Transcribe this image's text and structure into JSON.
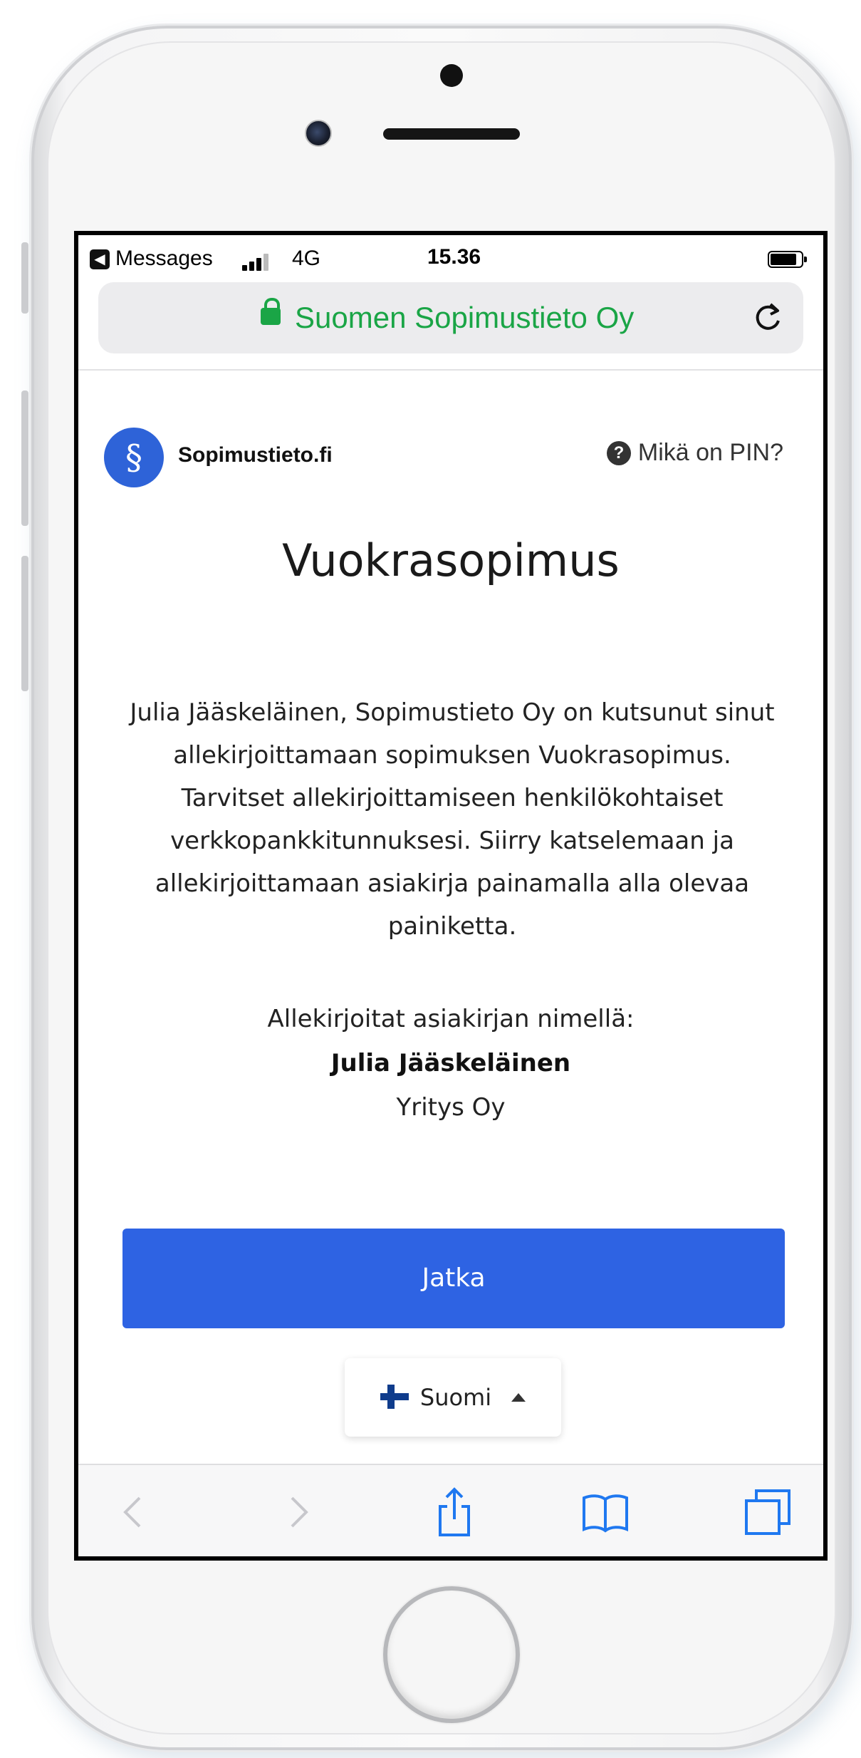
{
  "status_bar": {
    "app": "Messages",
    "network": "4G",
    "time": "15.36"
  },
  "url_bar": {
    "site": "Suomen Sopimustieto Oy"
  },
  "brand": {
    "logo_symbol": "§",
    "name": "Sopimustieto.fi"
  },
  "pin_help": {
    "label": "Mikä on PIN?"
  },
  "document": {
    "title": "Vuokrasopimus",
    "intro": "Julia Jääskeläinen, Sopimustieto Oy on kutsunut sinut allekirjoittamaan sopimuksen Vuokrasopimus. Tarvitset allekirjoittamiseen henkilökohtaiset verkkopankkitunnuksesi. Siirry katselemaan ja allekirjoittamaan asiakirja painamalla alla olevaa painiketta."
  },
  "signer": {
    "label": "Allekirjoitat asiakirjan nimellä:",
    "name": "Julia Jääskeläinen",
    "company": "Yritys Oy"
  },
  "actions": {
    "continue_label": "Jatka"
  },
  "language": {
    "selected": "Suomi"
  },
  "colors": {
    "accent": "#2e63e3",
    "secure_green": "#1aa546",
    "safari_blue": "#1f78f0"
  },
  "icons": {
    "lock": "lock-icon",
    "reload": "reload-icon",
    "help": "question-circle-icon",
    "flag": "finland-flag-icon",
    "share": "share-icon",
    "bookmarks": "book-icon",
    "tabs": "tabs-icon"
  }
}
